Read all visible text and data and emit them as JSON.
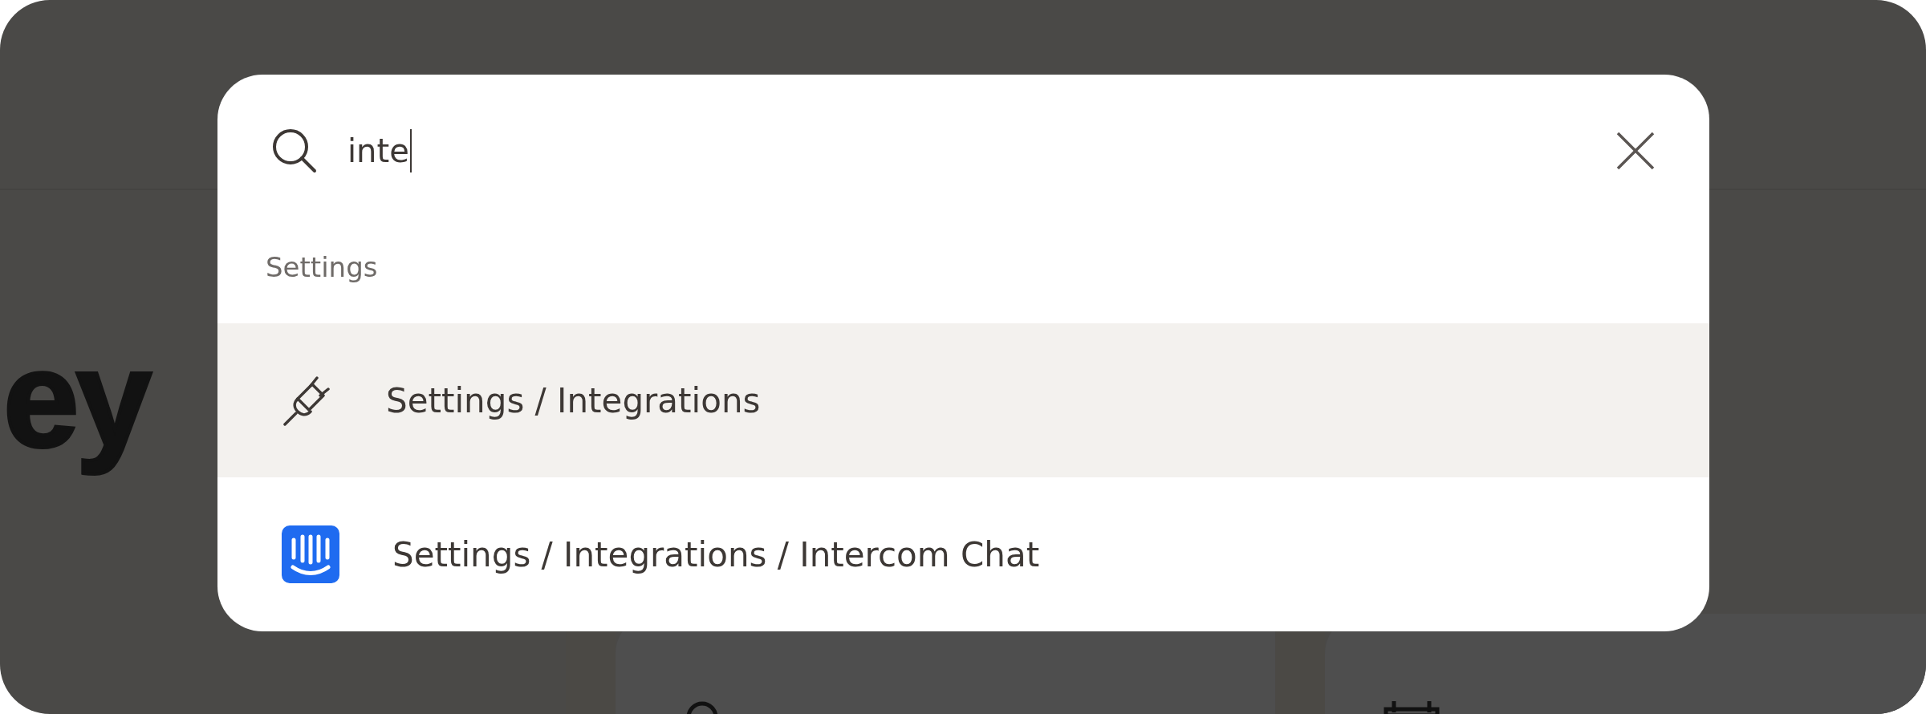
{
  "background": {
    "heading": "ey",
    "cards": [
      {
        "kind": "person"
      },
      {
        "kind": "calendar"
      }
    ]
  },
  "search": {
    "value": "inte"
  },
  "results": {
    "section": "Settings",
    "items": [
      {
        "label": "Settings / Integrations",
        "kind": "plug",
        "selected": true
      },
      {
        "label": "Settings / Integrations / Intercom Chat",
        "kind": "intercom",
        "selected": false
      }
    ]
  }
}
